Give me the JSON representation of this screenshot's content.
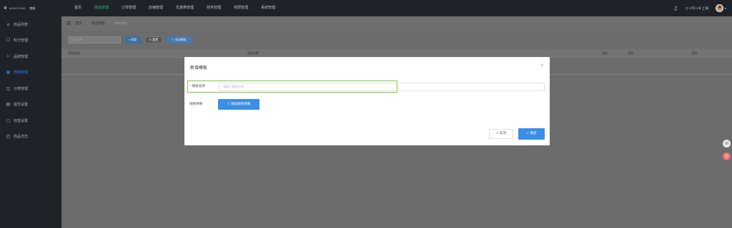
{
  "app": {
    "brand_text": "KONGTONAI",
    "app_name": "商城"
  },
  "topnav": {
    "items": [
      "首页",
      "商品管理",
      "订单管理",
      "店铺管理",
      "优惠券管理",
      "财务管理",
      "权限管理",
      "系统管理"
    ],
    "active_index": 1,
    "timezone": "UTC+8 上海"
  },
  "sidebar": {
    "items": [
      {
        "label": "商品列表",
        "icon": "home-icon"
      },
      {
        "label": "积分管理",
        "icon": "gift-icon"
      },
      {
        "label": "品牌管理",
        "icon": "flag-icon"
      },
      {
        "label": "规格管理",
        "icon": "spec-icon"
      },
      {
        "label": "分类管理",
        "icon": "category-icon"
      },
      {
        "label": "属性设置",
        "icon": "attribute-icon"
      },
      {
        "label": "标签设置",
        "icon": "tag-icon"
      },
      {
        "label": "商品日志",
        "icon": "log-icon"
      }
    ],
    "active_index": 3
  },
  "breadcrumb": {
    "items": [
      "首页",
      "商品管理",
      "规格模板"
    ],
    "separator": "/"
  },
  "toolbar": {
    "search_placeholder": "模板名称",
    "search_label": "搜索",
    "reset_label": "重置",
    "add_label": "添加模板"
  },
  "table": {
    "columns": [
      "模板名称",
      "规格参数",
      "类型",
      "状态",
      "操作"
    ]
  },
  "modal": {
    "title": "新增模板",
    "close_symbol": "×",
    "name_label": "模板名称",
    "required_mark": "*",
    "name_placeholder": "请输入模板名称",
    "params_label": "规格参数",
    "add_param_label": "+ 添加规格参数",
    "cancel_label": "× 取消",
    "confirm_label": "✓ 确定"
  },
  "colors": {
    "accent_green": "#2fb67c",
    "primary_blue": "#3a8ee6",
    "highlight_green": "#7ac943",
    "sidebar_bg": "#1f2329"
  }
}
